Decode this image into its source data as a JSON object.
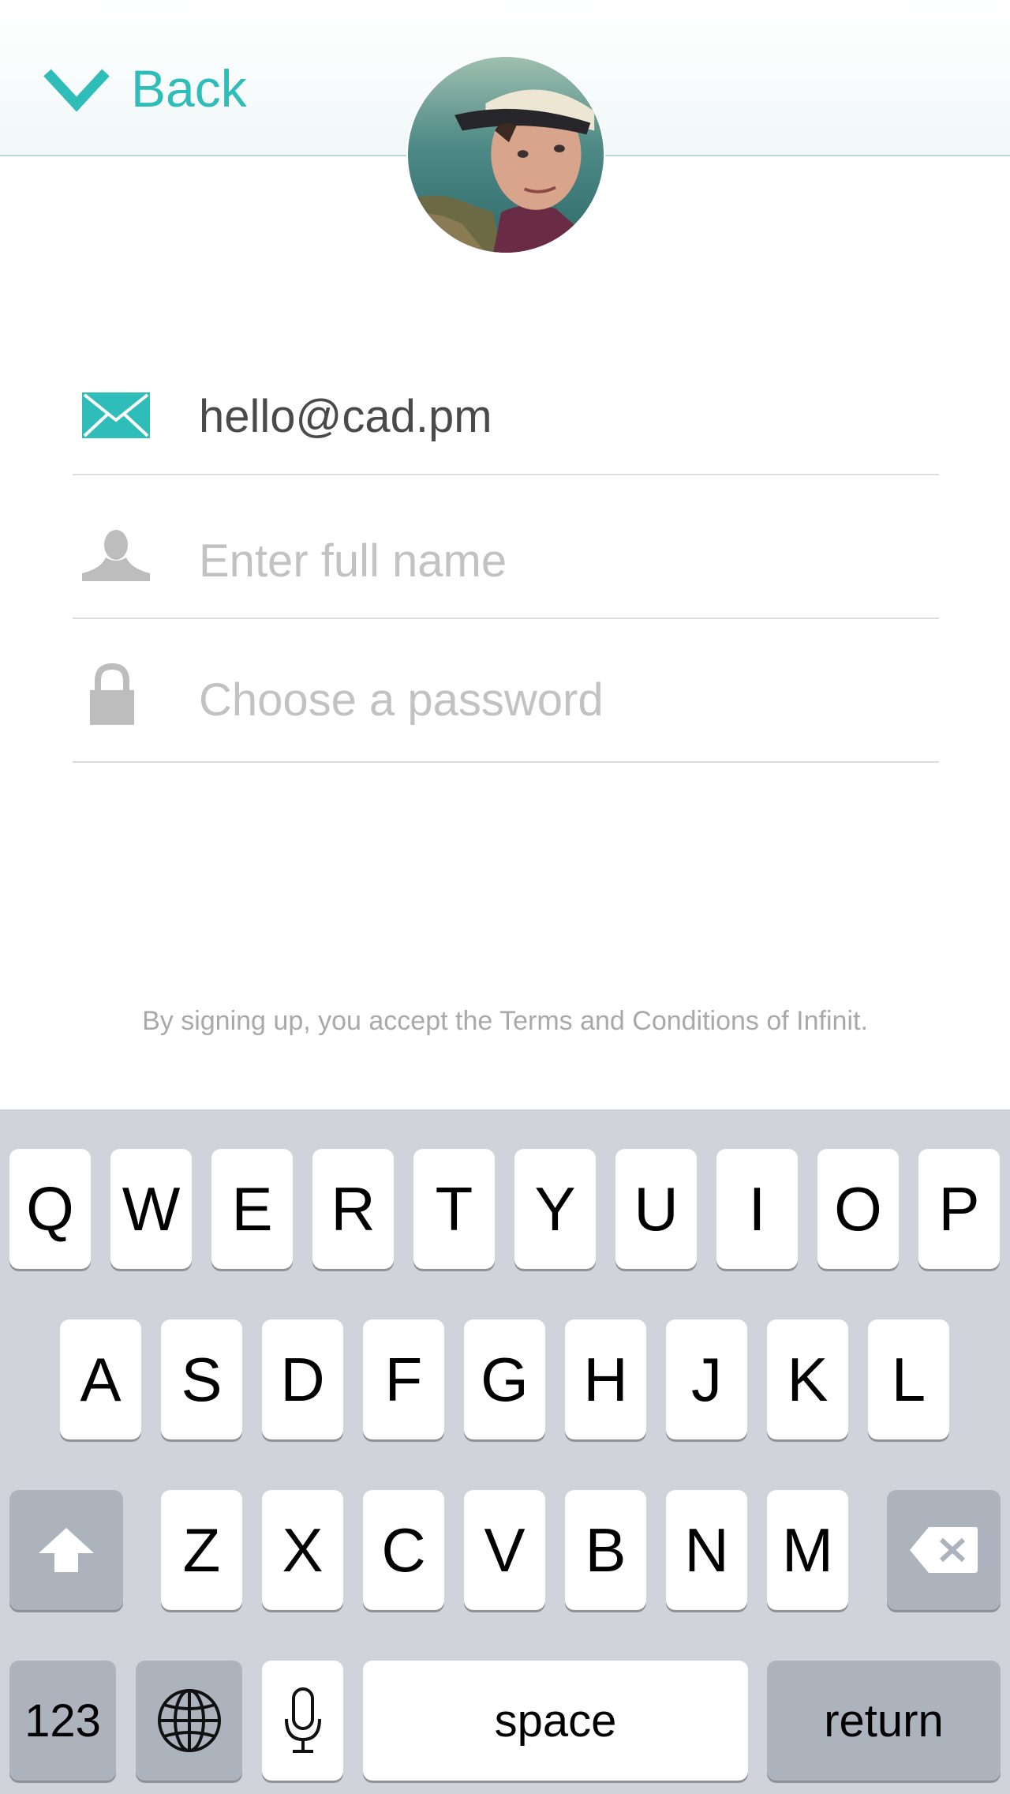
{
  "header": {
    "back_label": "Back",
    "back_icon": "chevron-down-icon"
  },
  "avatar": {
    "description_icon": "avatar"
  },
  "form": {
    "email": {
      "value": "hello@cad.pm",
      "icon": "envelope-icon"
    },
    "full_name": {
      "placeholder": "Enter full name",
      "icon": "person-icon"
    },
    "password": {
      "placeholder": "Choose a password",
      "icon": "lock-icon"
    }
  },
  "terms_text": "By signing up, you accept the Terms and Conditions of Infinit.",
  "keyboard": {
    "row1": [
      "Q",
      "W",
      "E",
      "R",
      "T",
      "Y",
      "U",
      "I",
      "O",
      "P"
    ],
    "row2": [
      "A",
      "S",
      "D",
      "F",
      "G",
      "H",
      "J",
      "K",
      "L"
    ],
    "row3": [
      "Z",
      "X",
      "C",
      "V",
      "B",
      "N",
      "M"
    ],
    "numbers_label": "123",
    "space_label": "space",
    "return_label": "return",
    "shift_icon": "shift-arrow-icon",
    "delete_icon": "backspace-icon",
    "globe_icon": "globe-icon",
    "mic_icon": "microphone-icon"
  },
  "colors": {
    "accent": "#2fbdb9",
    "placeholder": "#c2c2c2",
    "keyboard_bg": "#d0d3da"
  }
}
